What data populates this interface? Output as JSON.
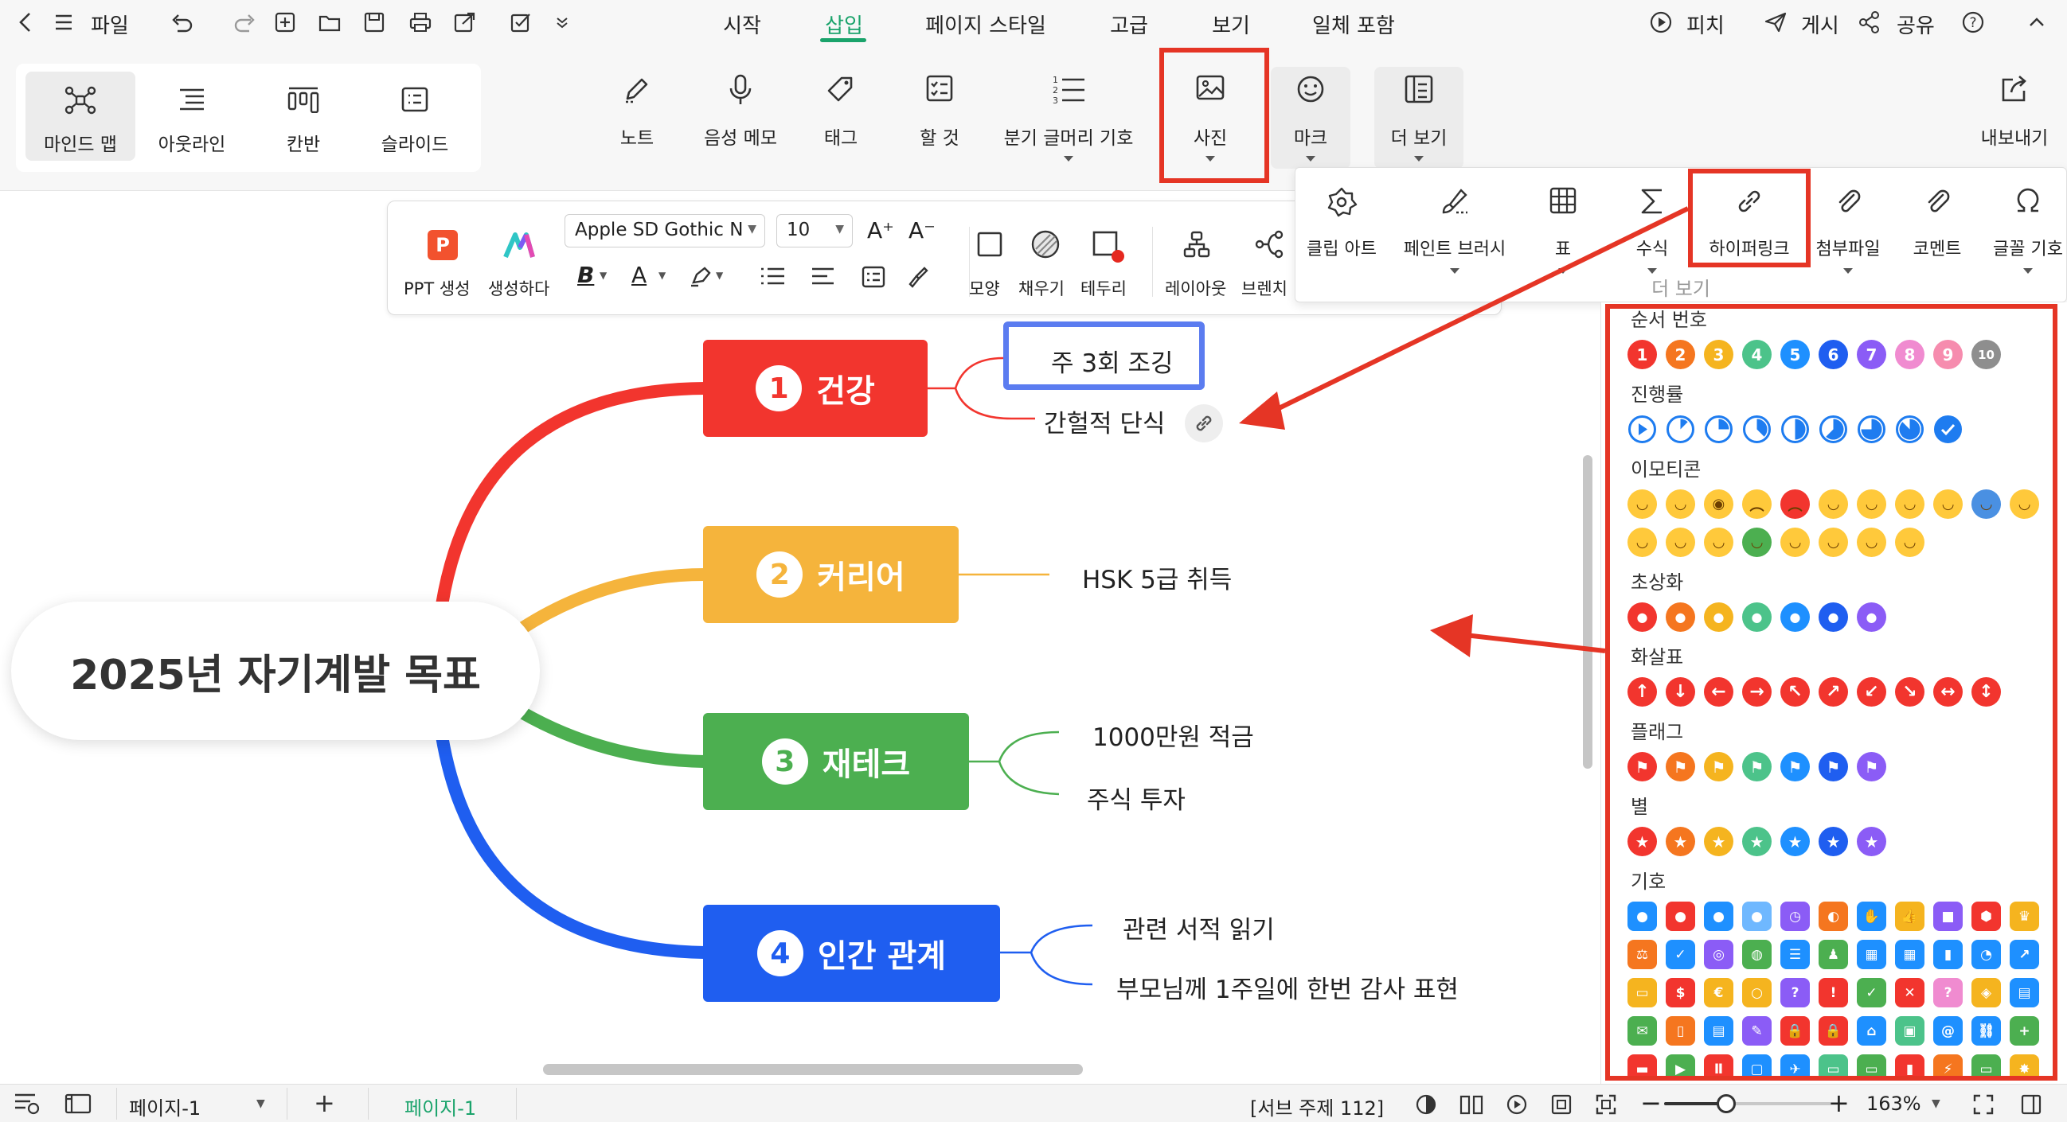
{
  "titlebar": {
    "file_label": "파일",
    "tabs": [
      "시작",
      "삽입",
      "페이지 스타일",
      "고급",
      "보기",
      "일체 포함"
    ],
    "active_tab": "삽입",
    "pitch_label": "피치",
    "publish_label": "게시",
    "share_label": "공유"
  },
  "ribbon": {
    "views": [
      "마인드 맵",
      "아웃라인",
      "칸반",
      "슬라이드"
    ],
    "active_view": "마인드 맵",
    "tools": {
      "note": "노트",
      "voice_memo": "음성 메모",
      "tag": "태그",
      "todo": "할 것",
      "numbering": "분기 글머리 기호",
      "photo": "사진",
      "mark": "마크",
      "more": "더 보기",
      "export": "내보내기"
    }
  },
  "more_panel": {
    "items": [
      "클립 아트",
      "페인트 브러시",
      "표",
      "수식",
      "하이퍼링크",
      "첨부파일",
      "코멘트",
      "글꼴 기호"
    ],
    "footer": "더 보기"
  },
  "format_toolbar": {
    "ppt_label": "PPT 생성",
    "generate_label": "생성하다",
    "font_family": "Apple SD Gothic N",
    "font_size": "10",
    "shape_label": "모양",
    "fill_label": "채우기",
    "border_label": "테두리",
    "layout_label": "레이아웃",
    "branch_label": "브렌치"
  },
  "mindmap": {
    "central": "2025년 자기계발 목표",
    "topics": [
      {
        "num": "1",
        "label": "건강",
        "color": "#f2352e",
        "subs": [
          "주 3회 조깅",
          "간헐적 단식"
        ]
      },
      {
        "num": "2",
        "label": "커리어",
        "color": "#f5b43c",
        "subs": [
          "HSK 5급 취득"
        ]
      },
      {
        "num": "3",
        "label": "재테크",
        "color": "#4caf50",
        "subs": [
          "1000만원 적금",
          "주식 투자"
        ]
      },
      {
        "num": "4",
        "label": "인간 관계",
        "color": "#1f5ef0",
        "subs": [
          "관련 서적 읽기",
          "부모님께 1주일에 한번 감사 표현"
        ]
      }
    ]
  },
  "icon_panel": {
    "sections": {
      "order": "순서 번호",
      "progress": "진행률",
      "emoticon": "이모티콘",
      "portrait": "초상화",
      "arrow": "화살표",
      "flag": "플래그",
      "star": "별",
      "symbol": "기호"
    },
    "order_numbers": [
      "1",
      "2",
      "3",
      "4",
      "5",
      "6",
      "7",
      "8",
      "9",
      "10"
    ],
    "colors": [
      "#f2352e",
      "#f5761f",
      "#f5b41f",
      "#4cc38a",
      "#1e90ff",
      "#1f5ef0",
      "#8b5cf6"
    ]
  },
  "statusbar": {
    "page_select": "페이지-1",
    "page_tab": "페이지-1",
    "sub_topic": "[서브 주제 112]",
    "zoom": "163%"
  }
}
